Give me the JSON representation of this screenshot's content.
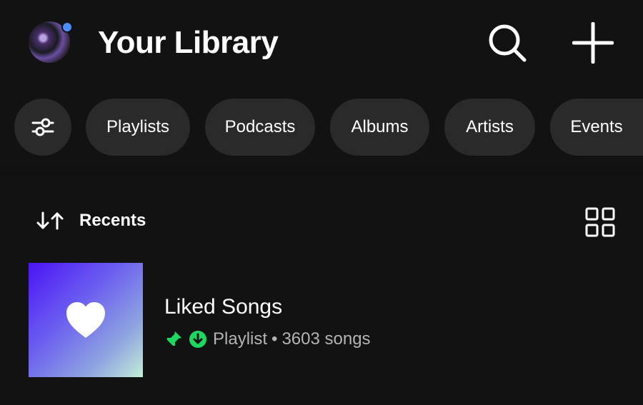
{
  "header": {
    "title": "Your Library",
    "avatar_status_color": "#4f8cff",
    "search_icon": "search-icon",
    "add_icon": "plus-icon"
  },
  "filters": {
    "filter_icon": "sliders-icon",
    "chips": [
      "Playlists",
      "Podcasts",
      "Albums",
      "Artists",
      "Events"
    ]
  },
  "sort": {
    "label": "Recents",
    "sort_icon": "sort-arrows-icon",
    "view_icon": "grid-view-icon"
  },
  "library_items": [
    {
      "title": "Liked Songs",
      "type": "Playlist",
      "separator": "•",
      "count": "3603 songs",
      "pinned": true,
      "downloaded": true,
      "accent": "#1ed760"
    }
  ],
  "colors": {
    "background": "#121212",
    "chip": "#2a2a2a",
    "secondary_text": "#b3b3b3",
    "green": "#1ed760"
  }
}
